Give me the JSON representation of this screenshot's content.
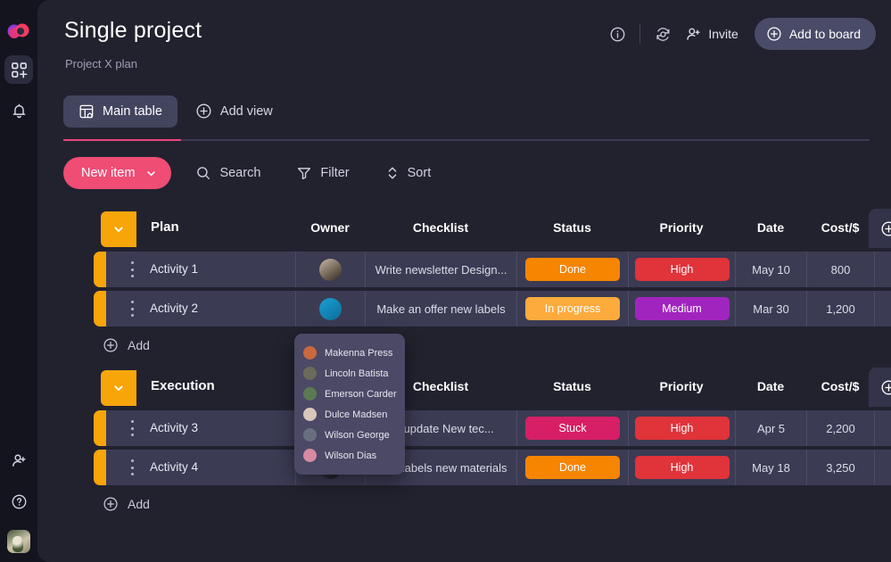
{
  "sidebar": {
    "logo": "monday-logo",
    "items": [
      {
        "name": "apps-grid-add-icon",
        "label": "Apps",
        "active": true
      },
      {
        "name": "bell-icon",
        "label": "Notifications",
        "active": false
      }
    ],
    "bottom_items": [
      {
        "name": "invite-member-icon",
        "label": "Invite members"
      },
      {
        "name": "help-icon",
        "label": "Help"
      }
    ],
    "avatar": "user-avatar"
  },
  "header": {
    "title": "Single project",
    "subtitle": "Project X plan",
    "info_icon": "info-icon",
    "activity_icon": "activity-log-icon",
    "invite_label": "Invite",
    "invite_icon": "person-add-icon",
    "add_to_board_label": "Add to board",
    "add_to_board_icon": "plus-circle-icon"
  },
  "views": {
    "main_tab_label": "Main table",
    "main_tab_icon": "table-home-icon",
    "add_view_label": "Add view",
    "add_view_icon": "plus-circle-icon",
    "accent_color": "#e8467c"
  },
  "toolbar": {
    "new_item_label": "New item",
    "new_item_caret": "chevron-down-icon",
    "new_item_color": "#ef4d74",
    "search_label": "Search",
    "search_icon": "search-icon",
    "filter_label": "Filter",
    "filter_icon": "funnel-icon",
    "sort_label": "Sort",
    "sort_icon": "sort-updown-icon"
  },
  "table": {
    "columns": [
      {
        "key": "plan",
        "label": "Plan"
      },
      {
        "key": "owner",
        "label": "Owner"
      },
      {
        "key": "checklist",
        "label": "Checklist"
      },
      {
        "key": "status",
        "label": "Status"
      },
      {
        "key": "priority",
        "label": "Priority"
      },
      {
        "key": "date",
        "label": "Date"
      },
      {
        "key": "cost",
        "label": "Cost/$"
      }
    ],
    "add_column_icon": "plus-circle-icon",
    "add_row_label": "Add",
    "add_row_icon": "plus-circle-icon",
    "group_color": "#f8a50a",
    "groups": [
      {
        "name": "Plan",
        "collapse_icon": "chevron-down-icon",
        "columns": [
          {
            "key": "plan",
            "label": "Plan"
          },
          {
            "key": "owner",
            "label": "Owner"
          },
          {
            "key": "checklist",
            "label": "Checklist"
          },
          {
            "key": "status",
            "label": "Status"
          },
          {
            "key": "priority",
            "label": "Priority"
          },
          {
            "key": "date",
            "label": "Date"
          },
          {
            "key": "cost",
            "label": "Cost/$"
          }
        ],
        "rows": [
          {
            "name": "Activity 1",
            "owner_avatar": "avatar-bride",
            "checklist": "Write newsletter Design...",
            "status": {
              "label": "Done",
              "color": "#f68500"
            },
            "priority": {
              "label": "High",
              "color": "#e0333a"
            },
            "date": "May 10",
            "cost": "800"
          },
          {
            "name": "Activity 2",
            "owner_avatar": "avatar-blue",
            "checklist": "Make an offer new labels",
            "status": {
              "label": "In progress",
              "color": "#fdab3d"
            },
            "priority": {
              "label": "Medium",
              "color": "#a025be"
            },
            "date": "Mar 30",
            "cost": "1,200"
          }
        ]
      },
      {
        "name": "Execution",
        "collapse_icon": "chevron-down-icon",
        "columns": [
          {
            "key": "plan",
            "label": ""
          },
          {
            "key": "owner",
            "label": ""
          },
          {
            "key": "checklist",
            "label": "Checklist"
          },
          {
            "key": "status",
            "label": "Status"
          },
          {
            "key": "priority",
            "label": "Priority"
          },
          {
            "key": "date",
            "label": "Date"
          },
          {
            "key": "cost",
            "label": "Cost/$"
          }
        ],
        "rows": [
          {
            "name": "Activity 3",
            "owner_avatar": "avatar-dark",
            "checklist": "es update New tec...",
            "status": {
              "label": "Stuck",
              "color": "#d61f64"
            },
            "priority": {
              "label": "High",
              "color": "#e0333a"
            },
            "date": "Apr 5",
            "cost": "2,200"
          },
          {
            "name": "Activity 4",
            "owner_avatar": "avatar-dark2",
            "checklist": "Print labels new materials",
            "status": {
              "label": "Done",
              "color": "#f68500"
            },
            "priority": {
              "label": "High",
              "color": "#e0333a"
            },
            "date": "May 18",
            "cost": "3,250"
          }
        ]
      }
    ]
  },
  "people_dropdown": {
    "items": [
      {
        "name": "Makenna Press",
        "avatar_color": "#c8693f"
      },
      {
        "name": "Lincoln Batista",
        "avatar_color": "#6b6b5a"
      },
      {
        "name": "Emerson Carder",
        "avatar_color": "#5c7a52"
      },
      {
        "name": "Dulce Madsen",
        "avatar_color": "#d8c7bb"
      },
      {
        "name": "Wilson George",
        "avatar_color": "#6a6f80"
      },
      {
        "name": "Wilson Dias",
        "avatar_color": "#d88ba0"
      }
    ]
  }
}
